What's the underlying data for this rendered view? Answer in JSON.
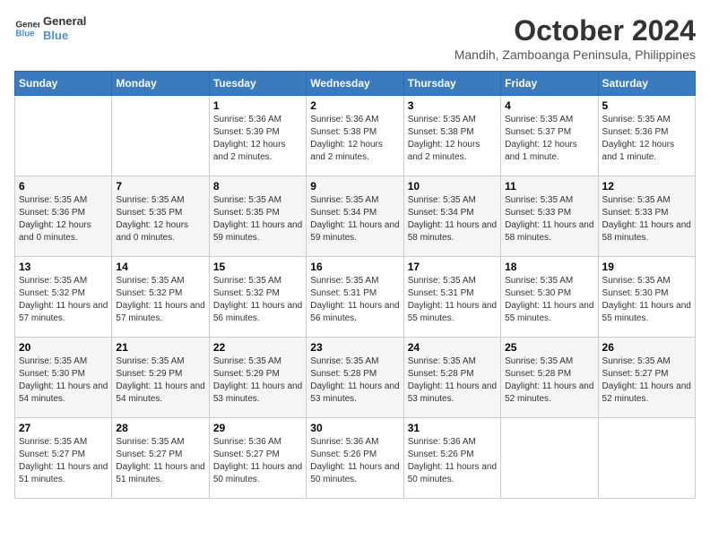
{
  "logo": {
    "line1": "General",
    "line2": "Blue"
  },
  "title": "October 2024",
  "subtitle": "Mandih, Zamboanga Peninsula, Philippines",
  "days_header": [
    "Sunday",
    "Monday",
    "Tuesday",
    "Wednesday",
    "Thursday",
    "Friday",
    "Saturday"
  ],
  "weeks": [
    [
      {
        "day": "",
        "info": ""
      },
      {
        "day": "",
        "info": ""
      },
      {
        "day": "1",
        "sunrise": "Sunrise: 5:36 AM",
        "sunset": "Sunset: 5:39 PM",
        "daylight": "Daylight: 12 hours and 2 minutes."
      },
      {
        "day": "2",
        "sunrise": "Sunrise: 5:36 AM",
        "sunset": "Sunset: 5:38 PM",
        "daylight": "Daylight: 12 hours and 2 minutes."
      },
      {
        "day": "3",
        "sunrise": "Sunrise: 5:35 AM",
        "sunset": "Sunset: 5:38 PM",
        "daylight": "Daylight: 12 hours and 2 minutes."
      },
      {
        "day": "4",
        "sunrise": "Sunrise: 5:35 AM",
        "sunset": "Sunset: 5:37 PM",
        "daylight": "Daylight: 12 hours and 1 minute."
      },
      {
        "day": "5",
        "sunrise": "Sunrise: 5:35 AM",
        "sunset": "Sunset: 5:36 PM",
        "daylight": "Daylight: 12 hours and 1 minute."
      }
    ],
    [
      {
        "day": "6",
        "sunrise": "Sunrise: 5:35 AM",
        "sunset": "Sunset: 5:36 PM",
        "daylight": "Daylight: 12 hours and 0 minutes."
      },
      {
        "day": "7",
        "sunrise": "Sunrise: 5:35 AM",
        "sunset": "Sunset: 5:35 PM",
        "daylight": "Daylight: 12 hours and 0 minutes."
      },
      {
        "day": "8",
        "sunrise": "Sunrise: 5:35 AM",
        "sunset": "Sunset: 5:35 PM",
        "daylight": "Daylight: 11 hours and 59 minutes."
      },
      {
        "day": "9",
        "sunrise": "Sunrise: 5:35 AM",
        "sunset": "Sunset: 5:34 PM",
        "daylight": "Daylight: 11 hours and 59 minutes."
      },
      {
        "day": "10",
        "sunrise": "Sunrise: 5:35 AM",
        "sunset": "Sunset: 5:34 PM",
        "daylight": "Daylight: 11 hours and 58 minutes."
      },
      {
        "day": "11",
        "sunrise": "Sunrise: 5:35 AM",
        "sunset": "Sunset: 5:33 PM",
        "daylight": "Daylight: 11 hours and 58 minutes."
      },
      {
        "day": "12",
        "sunrise": "Sunrise: 5:35 AM",
        "sunset": "Sunset: 5:33 PM",
        "daylight": "Daylight: 11 hours and 58 minutes."
      }
    ],
    [
      {
        "day": "13",
        "sunrise": "Sunrise: 5:35 AM",
        "sunset": "Sunset: 5:32 PM",
        "daylight": "Daylight: 11 hours and 57 minutes."
      },
      {
        "day": "14",
        "sunrise": "Sunrise: 5:35 AM",
        "sunset": "Sunset: 5:32 PM",
        "daylight": "Daylight: 11 hours and 57 minutes."
      },
      {
        "day": "15",
        "sunrise": "Sunrise: 5:35 AM",
        "sunset": "Sunset: 5:32 PM",
        "daylight": "Daylight: 11 hours and 56 minutes."
      },
      {
        "day": "16",
        "sunrise": "Sunrise: 5:35 AM",
        "sunset": "Sunset: 5:31 PM",
        "daylight": "Daylight: 11 hours and 56 minutes."
      },
      {
        "day": "17",
        "sunrise": "Sunrise: 5:35 AM",
        "sunset": "Sunset: 5:31 PM",
        "daylight": "Daylight: 11 hours and 55 minutes."
      },
      {
        "day": "18",
        "sunrise": "Sunrise: 5:35 AM",
        "sunset": "Sunset: 5:30 PM",
        "daylight": "Daylight: 11 hours and 55 minutes."
      },
      {
        "day": "19",
        "sunrise": "Sunrise: 5:35 AM",
        "sunset": "Sunset: 5:30 PM",
        "daylight": "Daylight: 11 hours and 55 minutes."
      }
    ],
    [
      {
        "day": "20",
        "sunrise": "Sunrise: 5:35 AM",
        "sunset": "Sunset: 5:30 PM",
        "daylight": "Daylight: 11 hours and 54 minutes."
      },
      {
        "day": "21",
        "sunrise": "Sunrise: 5:35 AM",
        "sunset": "Sunset: 5:29 PM",
        "daylight": "Daylight: 11 hours and 54 minutes."
      },
      {
        "day": "22",
        "sunrise": "Sunrise: 5:35 AM",
        "sunset": "Sunset: 5:29 PM",
        "daylight": "Daylight: 11 hours and 53 minutes."
      },
      {
        "day": "23",
        "sunrise": "Sunrise: 5:35 AM",
        "sunset": "Sunset: 5:28 PM",
        "daylight": "Daylight: 11 hours and 53 minutes."
      },
      {
        "day": "24",
        "sunrise": "Sunrise: 5:35 AM",
        "sunset": "Sunset: 5:28 PM",
        "daylight": "Daylight: 11 hours and 53 minutes."
      },
      {
        "day": "25",
        "sunrise": "Sunrise: 5:35 AM",
        "sunset": "Sunset: 5:28 PM",
        "daylight": "Daylight: 11 hours and 52 minutes."
      },
      {
        "day": "26",
        "sunrise": "Sunrise: 5:35 AM",
        "sunset": "Sunset: 5:27 PM",
        "daylight": "Daylight: 11 hours and 52 minutes."
      }
    ],
    [
      {
        "day": "27",
        "sunrise": "Sunrise: 5:35 AM",
        "sunset": "Sunset: 5:27 PM",
        "daylight": "Daylight: 11 hours and 51 minutes."
      },
      {
        "day": "28",
        "sunrise": "Sunrise: 5:35 AM",
        "sunset": "Sunset: 5:27 PM",
        "daylight": "Daylight: 11 hours and 51 minutes."
      },
      {
        "day": "29",
        "sunrise": "Sunrise: 5:36 AM",
        "sunset": "Sunset: 5:27 PM",
        "daylight": "Daylight: 11 hours and 50 minutes."
      },
      {
        "day": "30",
        "sunrise": "Sunrise: 5:36 AM",
        "sunset": "Sunset: 5:26 PM",
        "daylight": "Daylight: 11 hours and 50 minutes."
      },
      {
        "day": "31",
        "sunrise": "Sunrise: 5:36 AM",
        "sunset": "Sunset: 5:26 PM",
        "daylight": "Daylight: 11 hours and 50 minutes."
      },
      {
        "day": "",
        "info": ""
      },
      {
        "day": "",
        "info": ""
      }
    ]
  ]
}
